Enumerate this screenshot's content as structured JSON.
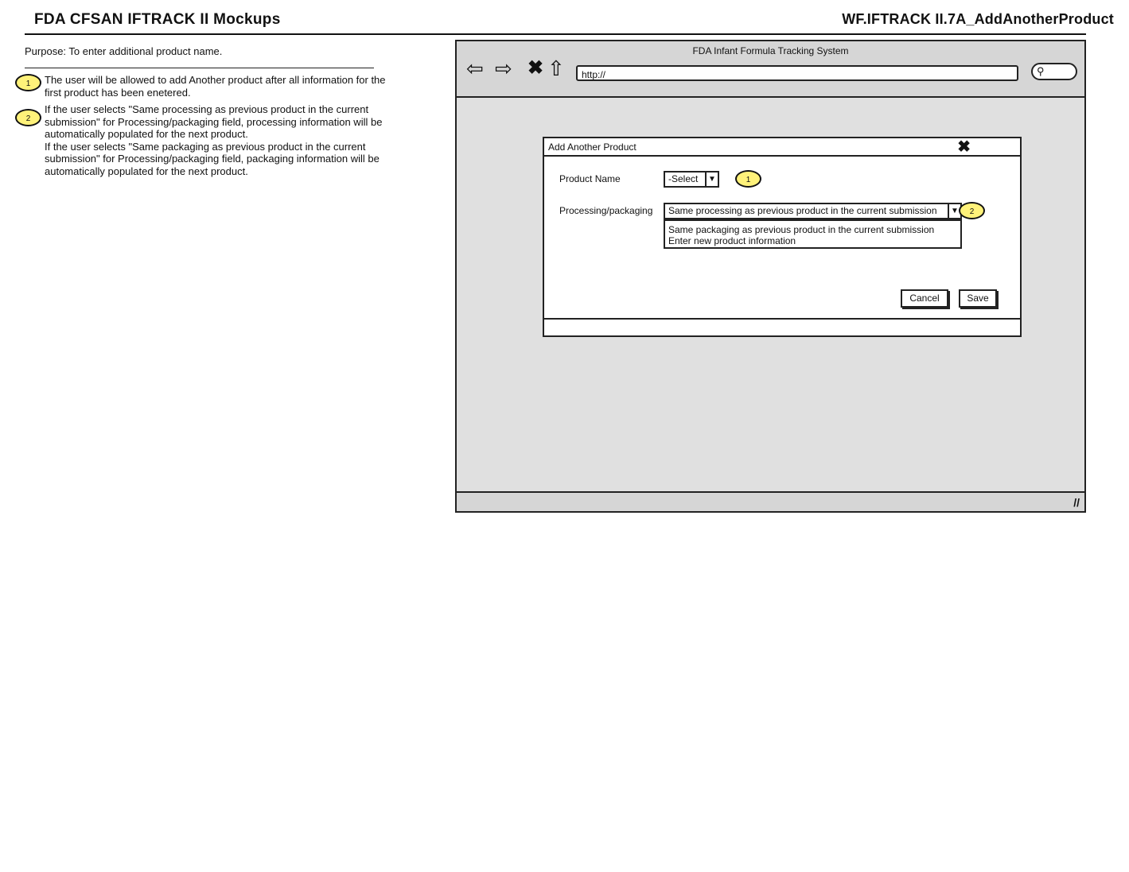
{
  "header": {
    "title": "FDA CFSAN IFTRACK II Mockups",
    "page_id": "WF.IFTRACK II.7A_AddAnotherProduct"
  },
  "purpose": "Purpose: To enter additional product name.",
  "notes": [
    {
      "number": "1",
      "lines": [
        "The user will be allowed to add Another product after all information for the first product has been enetered."
      ]
    },
    {
      "number": "2",
      "lines": [
        "If the user selects \"Same processing as previous product in the current submission\" for Processing/packaging field, processing information will be automatically populated for the next product.",
        "If the user selects \"Same packaging as previous product in the current submission\" for Processing/packaging field, packaging information will be automatically populated for the next product."
      ]
    }
  ],
  "browser": {
    "title": "FDA Infant Formula Tracking System",
    "url": "http://",
    "icons": [
      "back-icon",
      "forward-icon",
      "stop-icon",
      "home-icon",
      "search-icon",
      "resize-grip-icon"
    ]
  },
  "dialog": {
    "title": "Add Another Product",
    "product_name_label": "Product Name",
    "product_name_value": "-Select",
    "processing_label": "Processing/packaging",
    "processing_value": "Same processing as previous product in the current submission",
    "processing_options": [
      "Same packaging as previous product in the current submission",
      "Enter new product information"
    ],
    "cancel_label": "Cancel",
    "save_label": "Save",
    "callouts": [
      "1",
      "2"
    ]
  },
  "colors": {
    "callout": "#fff27a",
    "browser_bg": "#e0e0e0",
    "chrome": "#d6d6d6"
  }
}
